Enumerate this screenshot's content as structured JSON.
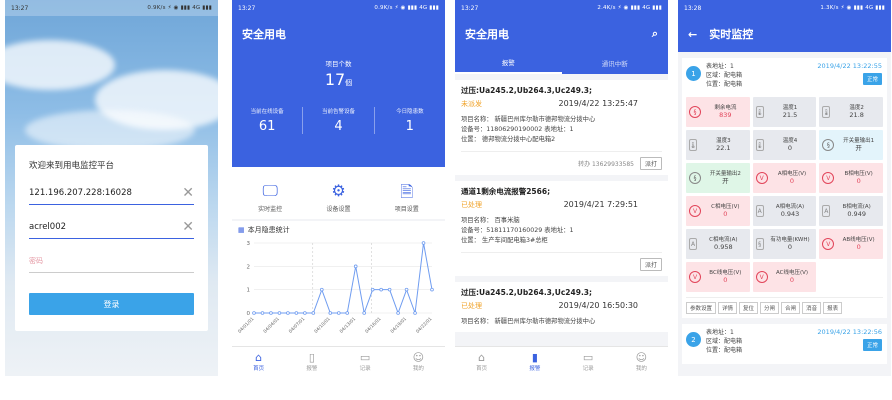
{
  "login": {
    "status_time": "13:27",
    "status_right": "0.9K/s ⚡ ◉ ▮▮▮ 4G ▮▮▮",
    "welcome": "欢迎来到用电监控平台",
    "server": "121.196.207.228:16028",
    "username": "acrel002",
    "password_placeholder": "密码",
    "login_button": "登录"
  },
  "home": {
    "status_time": "13:27",
    "status_right": "0.9K/s ⚡ ◉ ▮▮▮ 4G ▮▮▮",
    "title": "安全用电",
    "count_label": "项目个数",
    "count_value": "17",
    "count_unit": "個",
    "stats": [
      {
        "label": "当前在线设备",
        "value": "61"
      },
      {
        "label": "当前告警设备",
        "value": "4"
      },
      {
        "label": "今日隐患数",
        "value": "1"
      }
    ],
    "menu": [
      {
        "label": "实时监控",
        "icon": "monitor-icon"
      },
      {
        "label": "设备设置",
        "icon": "device-settings-icon"
      },
      {
        "label": "项目设置",
        "icon": "project-settings-icon"
      }
    ],
    "chart_title": "本月隐患统计",
    "tabs": [
      "首页",
      "报警",
      "记录",
      "我的"
    ]
  },
  "chart_data": {
    "type": "line",
    "title": "本月隐患统计",
    "ylim": [
      0,
      3
    ],
    "yticks": [
      "0",
      "1",
      "2",
      "3"
    ],
    "x": [
      "04/01",
      "04/02",
      "04/03",
      "04/04",
      "04/05",
      "04/06",
      "04/07",
      "04/08",
      "04/09",
      "04/10",
      "04/11",
      "04/12",
      "04/13",
      "04/14",
      "04/15",
      "04/16",
      "04/17",
      "04/18",
      "04/19",
      "04/20",
      "04/21",
      "04/22"
    ],
    "xtick_labels": [
      "04/01/01",
      "04/04/01",
      "04/07/01",
      "04/10/01",
      "04/13/01",
      "04/16/01",
      "04/19/01",
      "04/22/01"
    ],
    "values": [
      0,
      0,
      0,
      0,
      0,
      0,
      0,
      0,
      1,
      0,
      0,
      0,
      2,
      0,
      1,
      1,
      1,
      0,
      1,
      0,
      3,
      1
    ],
    "grid": true
  },
  "alarms": {
    "status_time": "13:27",
    "status_right": "2.4K/s ⚡ ◉ ▮▮▮ 4G ▮▮▮",
    "title": "安全用电",
    "subtabs": [
      "报警",
      "通讯中断"
    ],
    "items": [
      {
        "title": "过压:Ua245.2,Ub264.3,Uc249.3;",
        "status": "未派发",
        "time": "2019/4/22 13:25:47",
        "name": "项目名称：   新疆巴州库尔勒市德邦物流分拨中心",
        "device": "设备号：11806290190002 表地址：1",
        "location": "位置：      德邦物流分拨中心配电箱2",
        "footer": "转办   13629933585",
        "btn": "派打"
      },
      {
        "title": "通道1剩余电流报警2566;",
        "status": "已处理",
        "time": "2019/4/21 7:29:51",
        "name": "项目名称：   百事米脑",
        "device": "设备号：51811170160029 表地址：1",
        "location": "位置：      生产车间配电箱3#总柜",
        "footer": "",
        "btn": "派打"
      },
      {
        "title": "过压:Ua245.2,Ub264.3,Uc249.3;",
        "status": "已处理",
        "time": "2019/4/20 16:50:30",
        "name": "项目名称：   新疆巴州库尔勒市德邦物流分拨中心",
        "device": "",
        "location": "",
        "footer": "",
        "btn": ""
      }
    ],
    "tabs": [
      "首页",
      "报警",
      "记录",
      "我的"
    ]
  },
  "monitor": {
    "status_time": "13:28",
    "status_right": "1.3K/s ⚡ ◉ ▮▮▮ 4G ▮▮▮",
    "title": "实时监控",
    "devices": [
      {
        "no": "1",
        "addr": "表地址：1",
        "area": "区域：配电箱",
        "pos": "位置：配电箱",
        "time": "2019/4/22 13:22:55",
        "state": "正常"
      },
      {
        "no": "2",
        "addr": "表地址：1",
        "area": "区域：配电箱",
        "pos": "位置：配电箱",
        "time": "2019/4/22 13:22:56",
        "state": "正常"
      }
    ],
    "sensors": [
      {
        "label": "剩余电流",
        "value": "839",
        "style": "red",
        "glyph": "§"
      },
      {
        "label": "温度1",
        "value": "21.5",
        "style": "gray",
        "glyph": "🌡"
      },
      {
        "label": "温度2",
        "value": "21.8",
        "style": "gray",
        "glyph": "🌡"
      },
      {
        "label": "温度3",
        "value": "22.1",
        "style": "gray",
        "glyph": "🌡"
      },
      {
        "label": "温度4",
        "value": "0",
        "style": "gray",
        "glyph": "🌡"
      },
      {
        "label": "开关量输出1",
        "value": "开",
        "style": "lblue",
        "glyph": "§"
      },
      {
        "label": "开关量输出2",
        "value": "开",
        "style": "green",
        "glyph": "§"
      },
      {
        "label": "A相电压(V)",
        "value": "0",
        "style": "red",
        "glyph": "V"
      },
      {
        "label": "B相电压(V)",
        "value": "0",
        "style": "red",
        "glyph": "V"
      },
      {
        "label": "C相电压(V)",
        "value": "0",
        "style": "red",
        "glyph": "V"
      },
      {
        "label": "A相电流(A)",
        "value": "0.943",
        "style": "gray",
        "glyph": "A"
      },
      {
        "label": "B相电流(A)",
        "value": "0.949",
        "style": "gray",
        "glyph": "A"
      },
      {
        "label": "C相电流(A)",
        "value": "0.958",
        "style": "gray",
        "glyph": "A"
      },
      {
        "label": "有功电量(KWH)",
        "value": "0",
        "style": "gray",
        "glyph": "§"
      },
      {
        "label": "AB线电压(V)",
        "value": "0",
        "style": "red",
        "glyph": "V"
      },
      {
        "label": "BC线电压(V)",
        "value": "0",
        "style": "red",
        "glyph": "V"
      },
      {
        "label": "AC线电压(V)",
        "value": "0",
        "style": "red",
        "glyph": "V"
      }
    ],
    "actions": [
      "参数设置",
      "详情",
      "复位",
      "分闸",
      "合闸",
      "消音",
      "报表"
    ]
  }
}
